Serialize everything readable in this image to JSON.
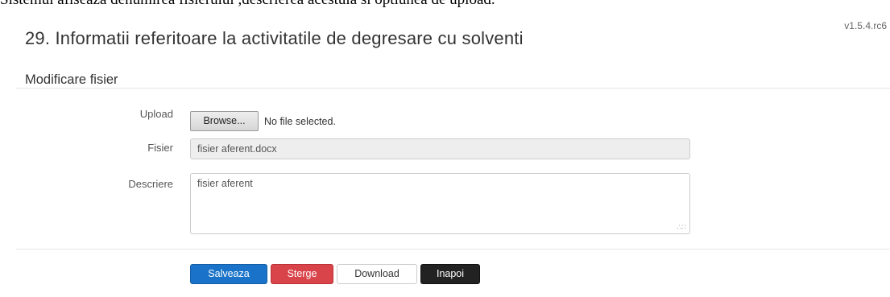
{
  "caption": "Sistemul afiseaza denumirea fisierului ,descrierea acestuia si optiunea de upload.",
  "version": "v1.5.4.rc6",
  "page_title": "29. Informatii referitoare la activitatile de degresare cu solventi",
  "section_title": "Modificare fisier",
  "form": {
    "upload_label": "Upload",
    "browse_label": "Browse...",
    "file_status": "No file selected.",
    "fisier_label": "Fisier",
    "fisier_value": "fisier aferent.docx",
    "descriere_label": "Descriere",
    "descriere_value": "fisier aferent"
  },
  "actions": {
    "save_label": "Salveaza",
    "delete_label": "Sterge",
    "download_label": "Download",
    "back_label": "Inapoi"
  },
  "colors": {
    "primary": "#1a73c8",
    "danger": "#d9434a",
    "dark": "#222222"
  }
}
